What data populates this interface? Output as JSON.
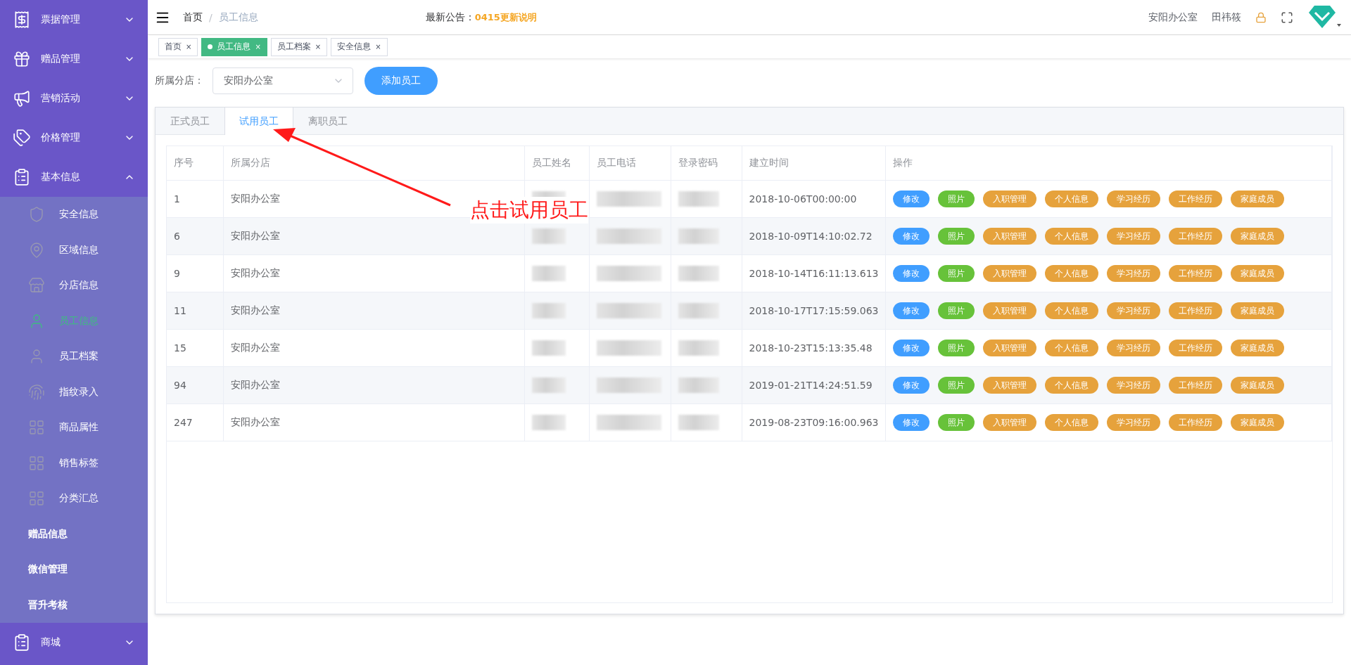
{
  "sidebar": {
    "items": [
      {
        "label": "票据管理",
        "expanded": false
      },
      {
        "label": "赠品管理",
        "expanded": false
      },
      {
        "label": "营销活动",
        "expanded": false
      },
      {
        "label": "价格管理",
        "expanded": false
      },
      {
        "label": "基本信息",
        "expanded": true,
        "children": [
          {
            "label": "安全信息",
            "selected": false
          },
          {
            "label": "区域信息",
            "selected": false
          },
          {
            "label": "分店信息",
            "selected": false
          },
          {
            "label": "员工信息",
            "selected": true
          },
          {
            "label": "员工档案",
            "selected": false
          },
          {
            "label": "指纹录入",
            "selected": false
          },
          {
            "label": "商品属性",
            "selected": false
          },
          {
            "label": "销售标签",
            "selected": false
          },
          {
            "label": "分类汇总",
            "selected": false
          },
          {
            "label": "赠品信息",
            "selected": false,
            "kind": "text"
          },
          {
            "label": "微信管理",
            "selected": false,
            "kind": "text"
          },
          {
            "label": "晋升考核",
            "selected": false,
            "kind": "text"
          }
        ]
      },
      {
        "label": "商城",
        "expanded": false
      }
    ]
  },
  "header": {
    "breadcrumb": [
      "首页",
      "员工信息"
    ],
    "breadcrumb_separator": "/",
    "notice_label": "最新公告：",
    "notice_link": "0415更新说明",
    "store": "安阳办公室",
    "user": "田祎筱"
  },
  "page_tabs": [
    {
      "label": "首页",
      "selected": false,
      "close": "×"
    },
    {
      "label": "员工信息",
      "selected": true,
      "close": "×"
    },
    {
      "label": "员工档案",
      "selected": false,
      "close": "×"
    },
    {
      "label": "安全信息",
      "selected": false,
      "close": "×"
    }
  ],
  "filter": {
    "label": "所属分店：",
    "value": "安阳办公室",
    "button": "添加员工"
  },
  "tabs": [
    {
      "label": "正式员工",
      "selected": false
    },
    {
      "label": "试用员工",
      "selected": true
    },
    {
      "label": "离职员工",
      "selected": false
    }
  ],
  "table": {
    "columns": [
      "序号",
      "所属分店",
      "员工姓名",
      "员工电话",
      "登录密码",
      "建立时间",
      "操作"
    ],
    "rows": [
      {
        "id": "1",
        "store": "安阳办公室",
        "created": "2018-10-06T00:00:00",
        "actions": [
          {
            "label": "修改",
            "kind": "primary"
          },
          {
            "label": "照片",
            "kind": "success"
          },
          {
            "label": "入职管理",
            "kind": "warning"
          },
          {
            "label": "个人信息",
            "kind": "warning"
          },
          {
            "label": "学习经历",
            "kind": "warning"
          },
          {
            "label": "工作经历",
            "kind": "warning"
          },
          {
            "label": "家庭成员",
            "kind": "warning"
          }
        ]
      },
      {
        "id": "6",
        "store": "安阳办公室",
        "created": "2018-10-09T14:10:02.72",
        "actions": [
          {
            "label": "修改",
            "kind": "primary"
          },
          {
            "label": "照片",
            "kind": "success"
          },
          {
            "label": "入职管理",
            "kind": "warning"
          },
          {
            "label": "个人信息",
            "kind": "warning"
          },
          {
            "label": "学习经历",
            "kind": "warning"
          },
          {
            "label": "工作经历",
            "kind": "warning"
          },
          {
            "label": "家庭成员",
            "kind": "warning"
          }
        ]
      },
      {
        "id": "9",
        "store": "安阳办公室",
        "created": "2018-10-14T16:11:13.613",
        "actions": [
          {
            "label": "修改",
            "kind": "primary"
          },
          {
            "label": "照片",
            "kind": "success"
          },
          {
            "label": "入职管理",
            "kind": "warning"
          },
          {
            "label": "个人信息",
            "kind": "warning"
          },
          {
            "label": "学习经历",
            "kind": "warning"
          },
          {
            "label": "工作经历",
            "kind": "warning"
          },
          {
            "label": "家庭成员",
            "kind": "warning"
          }
        ]
      },
      {
        "id": "11",
        "store": "安阳办公室",
        "created": "2018-10-17T17:15:59.063",
        "actions": [
          {
            "label": "修改",
            "kind": "primary"
          },
          {
            "label": "照片",
            "kind": "success"
          },
          {
            "label": "入职管理",
            "kind": "warning"
          },
          {
            "label": "个人信息",
            "kind": "warning"
          },
          {
            "label": "学习经历",
            "kind": "warning"
          },
          {
            "label": "工作经历",
            "kind": "warning"
          },
          {
            "label": "家庭成员",
            "kind": "warning"
          }
        ]
      },
      {
        "id": "15",
        "store": "安阳办公室",
        "created": "2018-10-23T15:13:35.48",
        "actions": [
          {
            "label": "修改",
            "kind": "primary"
          },
          {
            "label": "照片",
            "kind": "success"
          },
          {
            "label": "入职管理",
            "kind": "warning"
          },
          {
            "label": "个人信息",
            "kind": "warning"
          },
          {
            "label": "学习经历",
            "kind": "warning"
          },
          {
            "label": "工作经历",
            "kind": "warning"
          },
          {
            "label": "家庭成员",
            "kind": "warning"
          }
        ]
      },
      {
        "id": "94",
        "store": "安阳办公室",
        "created": "2019-01-21T14:24:51.59",
        "actions": [
          {
            "label": "修改",
            "kind": "primary"
          },
          {
            "label": "照片",
            "kind": "success"
          },
          {
            "label": "入职管理",
            "kind": "warning"
          },
          {
            "label": "个人信息",
            "kind": "warning"
          },
          {
            "label": "学习经历",
            "kind": "warning"
          },
          {
            "label": "工作经历",
            "kind": "warning"
          },
          {
            "label": "家庭成员",
            "kind": "warning"
          }
        ]
      },
      {
        "id": "247",
        "store": "安阳办公室",
        "created": "2019-08-23T09:16:00.963",
        "actions": [
          {
            "label": "修改",
            "kind": "primary"
          },
          {
            "label": "照片",
            "kind": "success"
          },
          {
            "label": "入职管理",
            "kind": "warning"
          },
          {
            "label": "个人信息",
            "kind": "warning"
          },
          {
            "label": "学习经历",
            "kind": "warning"
          },
          {
            "label": "工作经历",
            "kind": "warning"
          },
          {
            "label": "家庭成员",
            "kind": "warning"
          }
        ]
      }
    ]
  },
  "annotation": {
    "text": "点击试用员工"
  }
}
